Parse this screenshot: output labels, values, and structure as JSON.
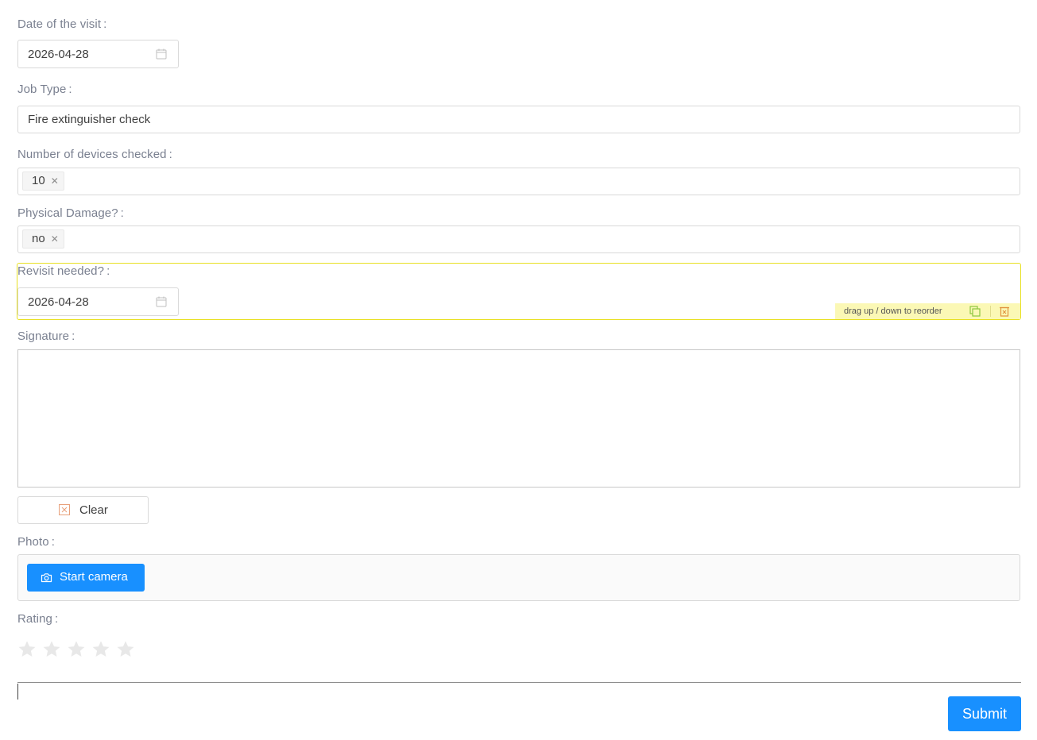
{
  "fields": {
    "visit_date": {
      "label": "Date of the visit",
      "value": "2026-04-28"
    },
    "job_type": {
      "label": "Job Type",
      "value": "Fire extinguisher check"
    },
    "devices_checked": {
      "label": "Number of devices checked",
      "tag": "10"
    },
    "physical_damage": {
      "label": "Physical Damage?",
      "tag": "no"
    },
    "revisit_needed": {
      "label": "Revisit needed?",
      "value": "2026-04-28"
    },
    "signature": {
      "label": "Signature",
      "clear_label": "Clear"
    },
    "photo": {
      "label": "Photo",
      "camera_label": "Start camera"
    },
    "rating": {
      "label": "Rating",
      "value": 0,
      "max": 5
    }
  },
  "colon": ":",
  "reorder_hint": "drag up / down to reorder",
  "submit_label": "Submit",
  "colors": {
    "primary": "#1890ff",
    "selected_outline": "#e8e023",
    "reorder_bar_bg": "#fbf8b5",
    "star_empty": "#e8e8e8",
    "clear_icon": "#e8a07a"
  },
  "icons": {
    "calendar": "calendar-icon",
    "tag_close": "close-icon",
    "copy": "copy-icon",
    "delete": "delete-icon",
    "clear": "clear-icon",
    "camera": "camera-icon",
    "star": "star-icon"
  }
}
